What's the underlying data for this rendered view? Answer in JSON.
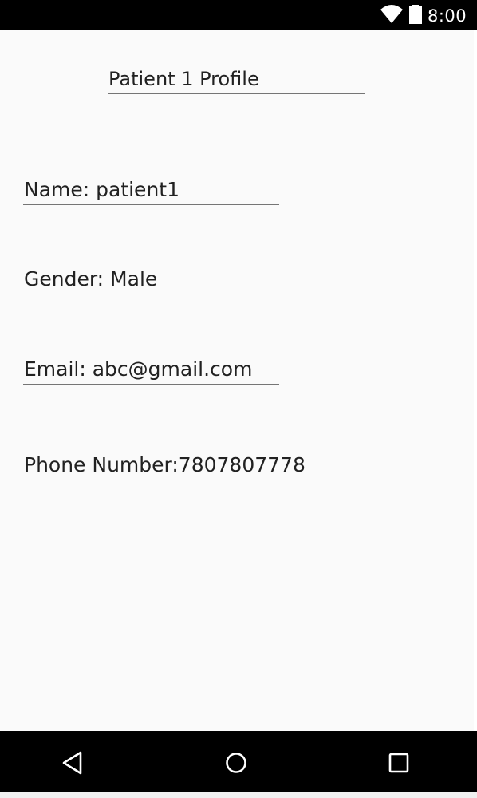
{
  "status_bar": {
    "time": "8:00",
    "wifi_icon": "wifi-icon",
    "battery_icon": "battery-icon"
  },
  "profile": {
    "title": "Patient 1 Profile",
    "name": "Name: patient1",
    "gender": "Gender: Male",
    "email": "Email: abc@gmail.com",
    "phone": "Phone Number:7807807778"
  },
  "nav_bar": {
    "back_icon": "back-triangle-icon",
    "home_icon": "home-circle-icon",
    "recents_icon": "recents-square-icon"
  },
  "colors": {
    "background": "#fafafa",
    "text": "#212121",
    "underline": "#757575",
    "bars": "#000000"
  }
}
